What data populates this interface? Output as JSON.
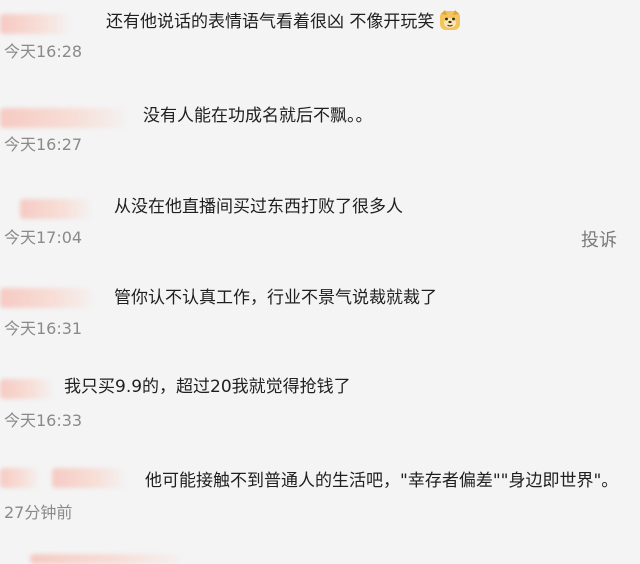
{
  "comments": [
    {
      "text": "还有他说话的表情语气看着很凶 不像开玩笑",
      "time": "今天16:28",
      "emoji": "dog-face-emoji"
    },
    {
      "text": "没有人能在功成名就后不飘。。",
      "time": "今天16:27"
    },
    {
      "text": "从没在他直播间买过东西打败了很多人",
      "time": "今天17:04"
    },
    {
      "text": "管你认不认真工作，行业不景气说裁就裁了",
      "time": "今天16:31"
    },
    {
      "text": "我只买9.9的，超过20我就觉得抢钱了",
      "time": "今天16:33"
    },
    {
      "text": "他可能接触不到普通人的生活吧，\"幸存者偏差\"\"身边即世界\"。",
      "time": "27分钟前"
    }
  ],
  "report_label": "投诉"
}
